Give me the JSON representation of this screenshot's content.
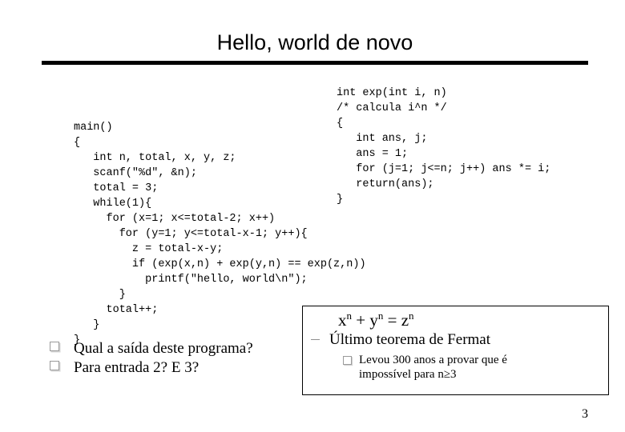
{
  "slide": {
    "title": "Hello, world de novo",
    "page_number": "3"
  },
  "code_main": "main()\n{\n   int n, total, x, y, z;\n   scanf(\"%d\", &n);\n   total = 3;\n   while(1){\n     for (x=1; x<=total-2; x++)\n       for (y=1; y<=total-x-1; y++){\n         z = total-x-y;\n         if (exp(x,n) + exp(y,n) == exp(z,n))\n           printf(\"hello, world\\n\");\n       }\n     total++;\n   }\n}",
  "code_exp": "int exp(int i, n)\n/* calcula i^n */\n{\n   int ans, j;\n   ans = 1;\n   for (j=1; j<=n; j++) ans *= i;\n   return(ans);\n}",
  "questions": [
    {
      "bullet": "square-bullet-icon",
      "text": "Qual a saída deste programa?"
    },
    {
      "bullet": "square-bullet-icon",
      "text": "Para entrada 2? E 3?"
    }
  ],
  "fermat": {
    "equation_x": "x",
    "equation_sup1": "n",
    "equation_plus": " + y",
    "equation_sup2": "n",
    "equation_eq": " = z",
    "equation_sup3": "n",
    "equation_plain": "xn + yn = zn",
    "theorem": "Último teorema de Fermat",
    "note": "Levou 300 anos a provar que é\nimpossível para n≥3"
  },
  "colors": {
    "background": "#ffffff",
    "text": "#000000",
    "rule": "#000000",
    "bullet_outline": "#9a9a9a",
    "bullet_shadow": "#d4d4d4",
    "dash_bullet": "#8f8f8f",
    "box_border": "#000000"
  }
}
